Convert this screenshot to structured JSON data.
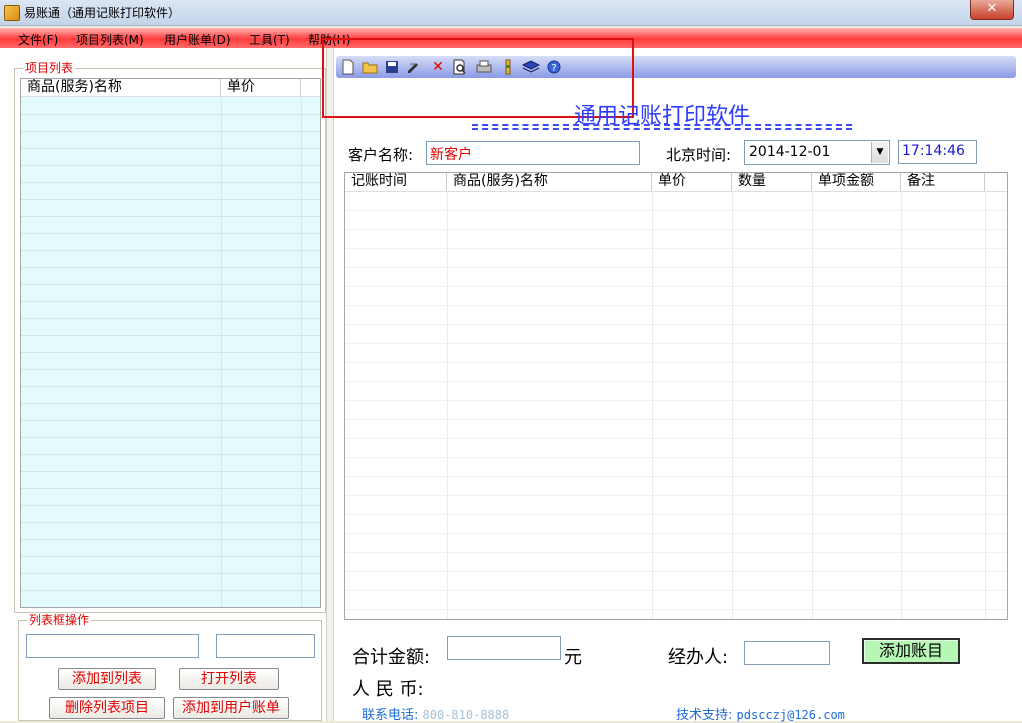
{
  "window": {
    "title": "易账通（通用记账打印软件）",
    "close_label": "✕"
  },
  "menu": {
    "items": [
      "文件(F)",
      "项目列表(M)",
      "用户账单(D)",
      "工具(T)",
      "帮助(H)"
    ]
  },
  "left_panel": {
    "group_title": "项目列表",
    "columns": [
      "商品(服务)名称",
      "单价"
    ],
    "ops_title": "列表框操作",
    "input1_value": "",
    "input2_value": "",
    "buttons": [
      "添加到列表",
      "打开列表",
      "删除列表项目",
      "添加到用户账单"
    ]
  },
  "toolbar": {
    "icons": [
      "new-file-icon",
      "open-folder-icon",
      "save-icon",
      "edit-icon",
      "delete-icon",
      "print-preview-icon",
      "print-icon",
      "settings-icon",
      "book-icon",
      "help-icon"
    ]
  },
  "main": {
    "heading": "通用记账打印软件",
    "customer_label": "客户名称:",
    "customer_value": "新客户",
    "time_label": "北京时间:",
    "date_value": "2014-12-01",
    "time_value": "17:14:46",
    "columns": [
      "记账时间",
      "商品(服务)名称",
      "单价",
      "数量",
      "单项金额",
      "备注"
    ]
  },
  "summary": {
    "total_label": "合计金额:",
    "total_value": "",
    "unit": "元",
    "rmb_label": "人 民 币:",
    "operator_label": "经办人:",
    "operator_value": "",
    "add_button": "添加账目"
  },
  "footer": {
    "phone_label": "联系电话:",
    "phone_value": "800-810-8888",
    "support_label": "技术支持:",
    "support_value": "pdscczj@126.com"
  },
  "colors": {
    "menu_bar": "#ff3c3c",
    "accent_red": "#e00000",
    "heading_blue": "#2e3cff",
    "list_bg": "#e3fbfd",
    "add_button": "#b6f7b6"
  }
}
